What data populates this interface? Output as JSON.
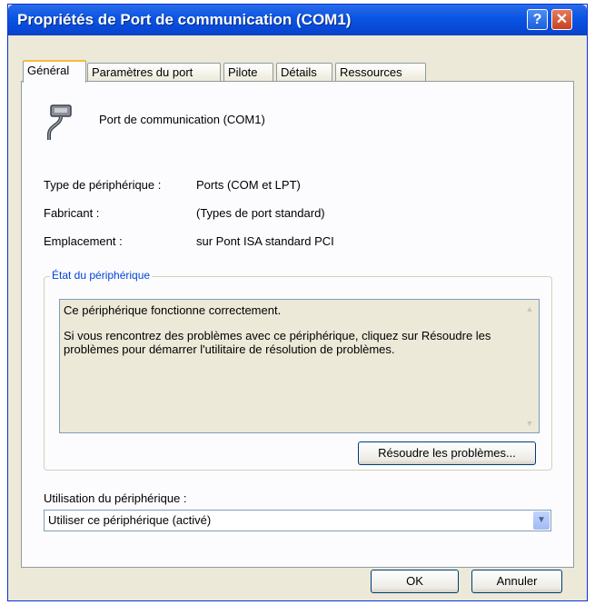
{
  "window": {
    "title": "Propriétés de Port de communication (COM1)"
  },
  "titlebar": {
    "help_glyph": "?",
    "close_glyph": "✕"
  },
  "tabs": [
    {
      "label": "Général",
      "active": true
    },
    {
      "label": "Paramètres du port",
      "active": false
    },
    {
      "label": "Pilote",
      "active": false
    },
    {
      "label": "Détails",
      "active": false
    },
    {
      "label": "Ressources",
      "active": false
    }
  ],
  "device": {
    "icon": "serial-port-icon",
    "name": "Port de communication (COM1)"
  },
  "properties": [
    {
      "label": "Type de périphérique :",
      "value": "Ports (COM et LPT)"
    },
    {
      "label": "Fabricant :",
      "value": "(Types de port standard)"
    },
    {
      "label": "Emplacement :",
      "value": "sur Pont ISA standard PCI"
    }
  ],
  "status_group": {
    "label": "État du périphérique",
    "text1": "Ce périphérique fonctionne correctement.",
    "text2": "Si vous rencontrez des problèmes avec ce périphérique, cliquez sur Résoudre les problèmes pour démarrer l'utilitaire de résolution de problèmes.",
    "troubleshoot_label": "Résoudre les problèmes..."
  },
  "usage": {
    "label": "Utilisation du périphérique :",
    "selected": "Utiliser ce périphérique (activé)"
  },
  "buttons": {
    "ok": "OK",
    "cancel": "Annuler"
  },
  "colors": {
    "title_bar": "#0a54e3",
    "group_label": "#0046d5",
    "dialog_bg": "#ece9d8"
  }
}
